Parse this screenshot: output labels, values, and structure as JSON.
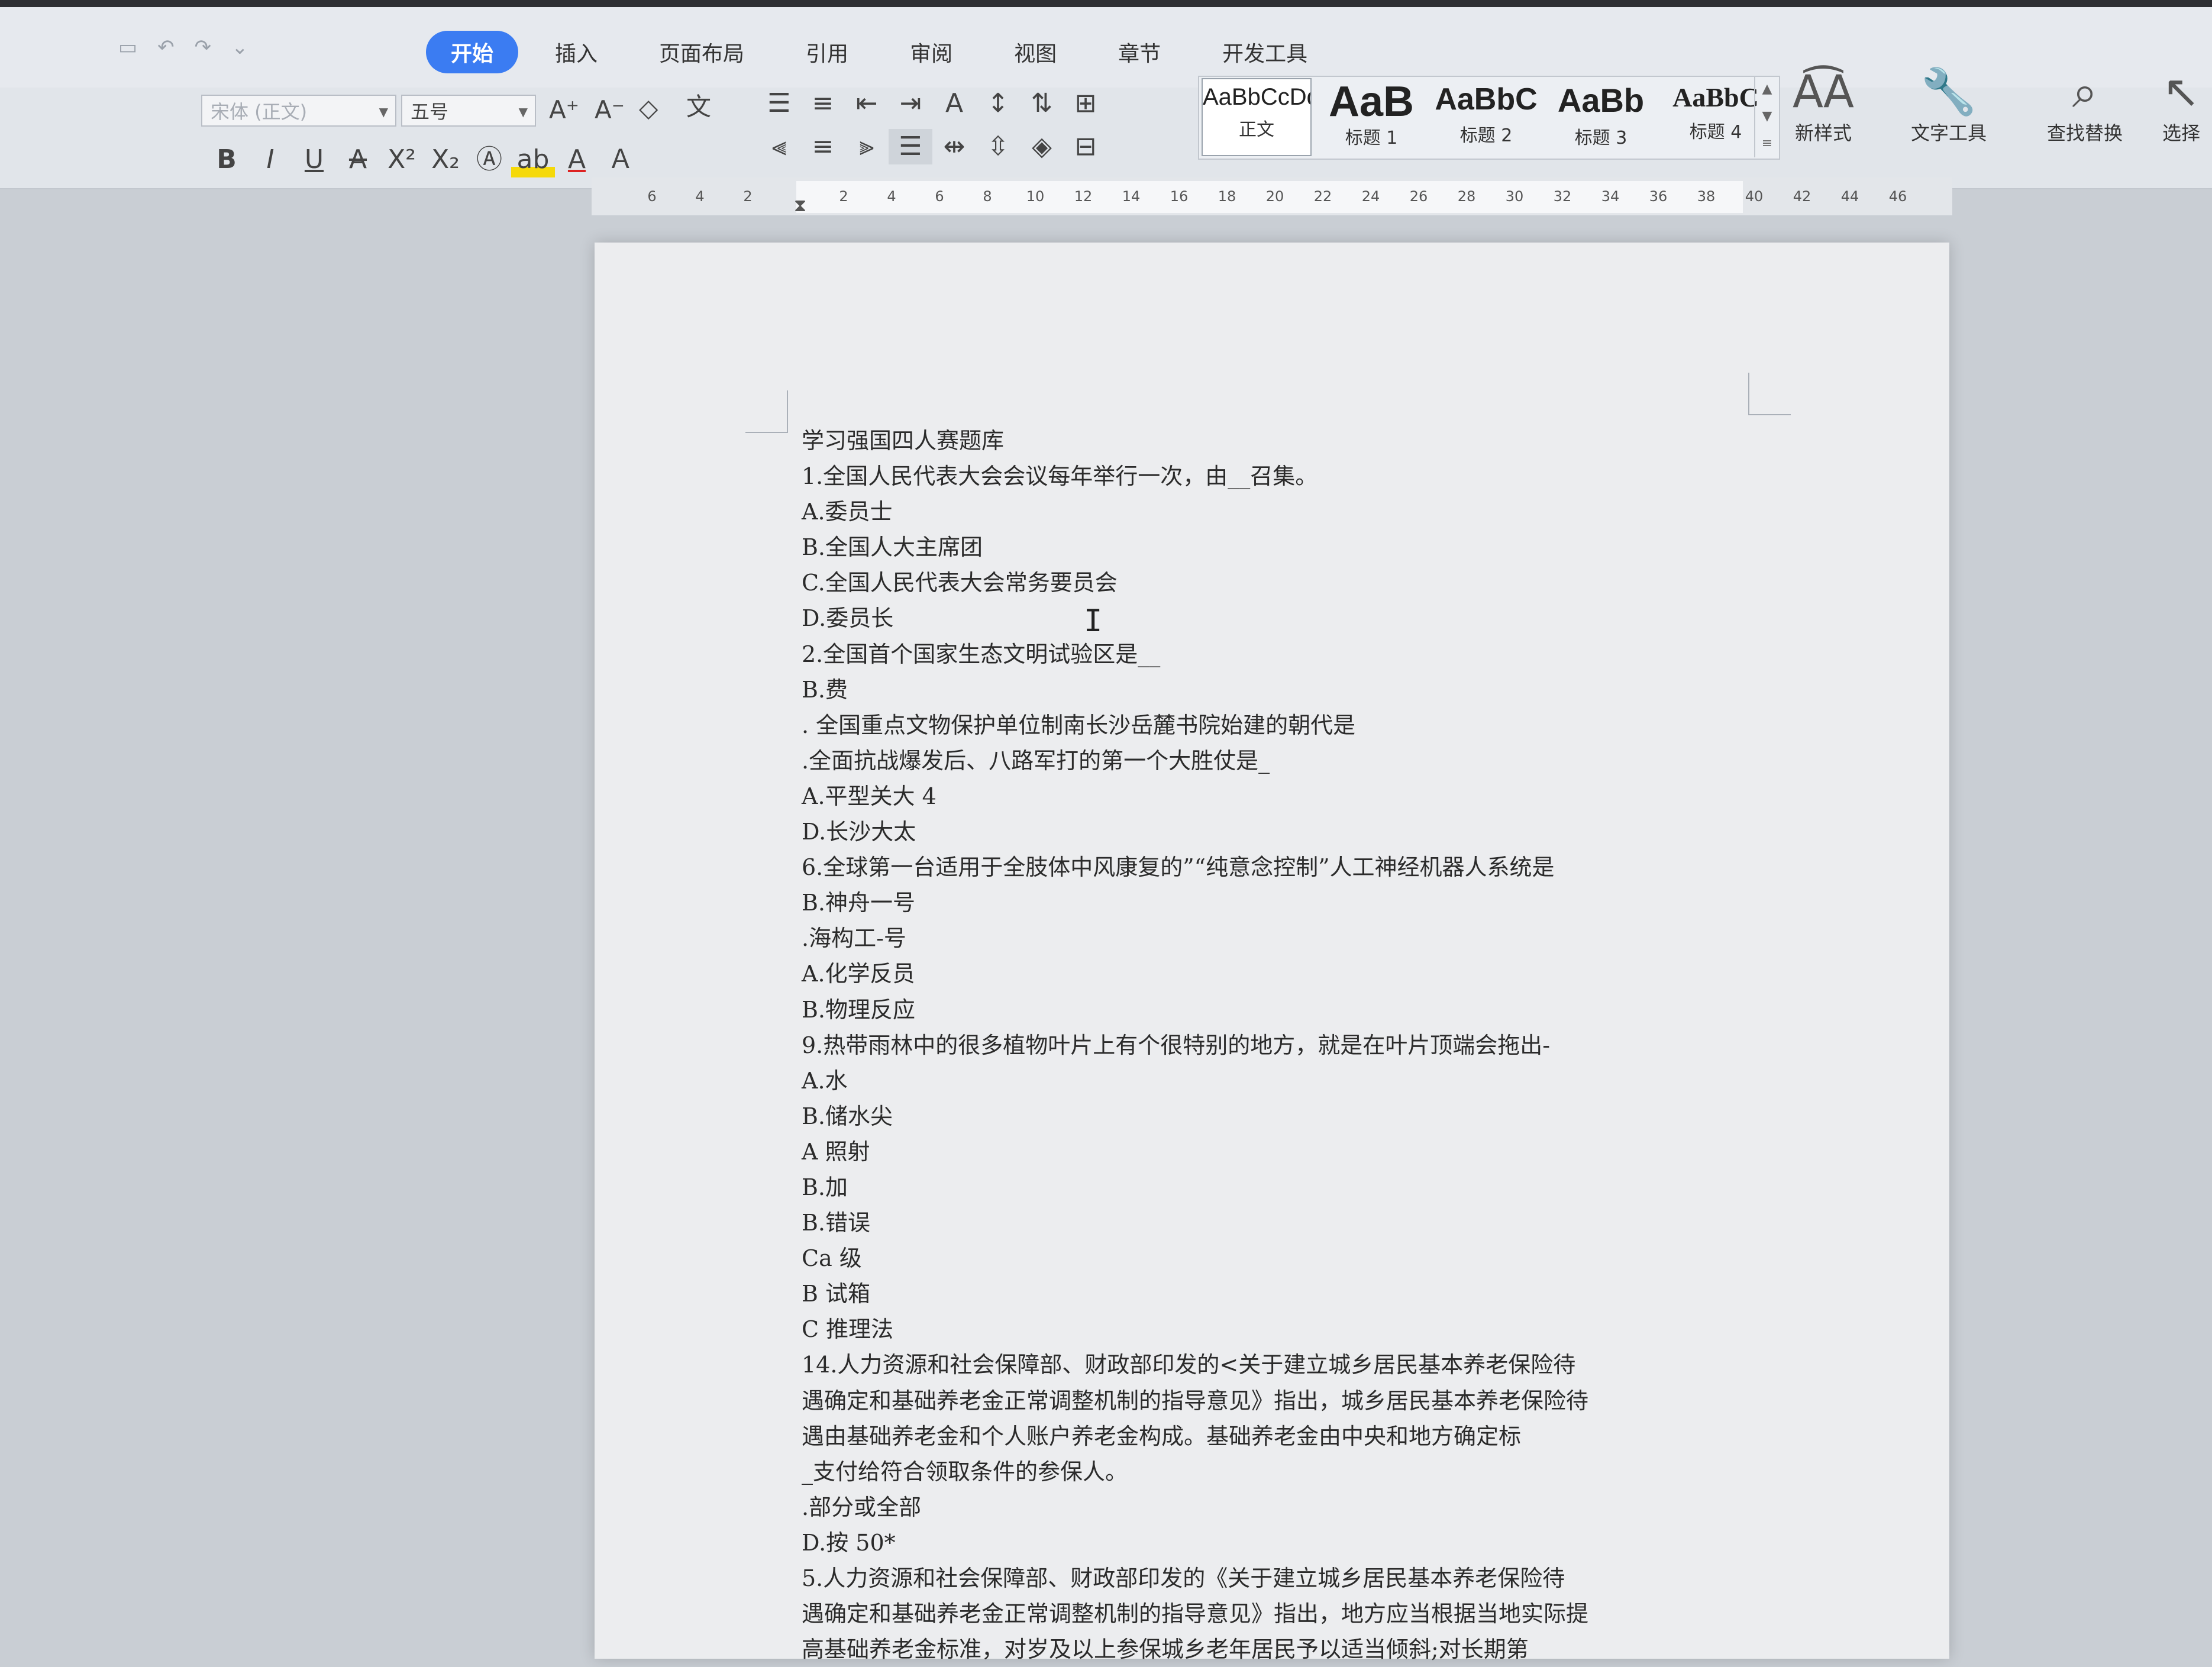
{
  "tabs": [
    {
      "label": "开始",
      "active": true
    },
    {
      "label": "插入",
      "active": false
    },
    {
      "label": "页面布局",
      "active": false
    },
    {
      "label": "引用",
      "active": false
    },
    {
      "label": "审阅",
      "active": false
    },
    {
      "label": "视图",
      "active": false
    },
    {
      "label": "章节",
      "active": false
    },
    {
      "label": "开发工具",
      "active": false
    }
  ],
  "font": {
    "family": "宋体 (正文)",
    "size": "五号"
  },
  "style_gallery": [
    {
      "sample": "AaBbCcDd",
      "label": "正文",
      "selected": true
    },
    {
      "sample": "AaB",
      "label": "标题 1",
      "selected": false
    },
    {
      "sample": "AaBbC",
      "label": "标题 2",
      "selected": false
    },
    {
      "sample": "AaBb",
      "label": "标题 3",
      "selected": false
    },
    {
      "sample": "AaBbC",
      "label": "标题 4",
      "selected": false
    }
  ],
  "tools": {
    "new_style": "新样式",
    "text_tools": "文字工具",
    "find_replace": "查找替换",
    "select": "选择"
  },
  "ruler_ticks": [
    "6",
    "4",
    "2",
    "2",
    "4",
    "6",
    "8",
    "10",
    "12",
    "14",
    "16",
    "18",
    "20",
    "22",
    "24",
    "26",
    "28",
    "30",
    "32",
    "34",
    "36",
    "38",
    "40",
    "42",
    "44",
    "46"
  ],
  "document_lines": [
    "学习强国四人赛题库",
    "1.全国人民代表大会会议每年举行一次，由__召集。",
    "A.委员士",
    "B.全国人大主席团",
    "C.全国人民代表大会常务要员会",
    "D.委员长",
    "2.全国首个国家生态文明试验区是__",
    "B.费",
    ". 全国重点文物保护单位制南长沙岳麓书院始建的朝代是",
    ".全面抗战爆发后、八路军打的第一个大胜仗是_",
    "A.平型关大 4",
    "D.长沙大太",
    "6.全球第一台适用于全肢体中风康复的”“纯意念控制”人工神经机器人系统是",
    "B.神舟一号",
    ".海构工-号",
    "A.化学反员",
    "B.物理反应",
    "9.热带雨林中的很多植物叶片上有个很特别的地方，就是在叶片顶端会拖出-",
    "A.水",
    "B.储水尖",
    "A 照射",
    "B.加",
    "B.错误",
    "Ca 级",
    "B 试箱",
    "C 推理法",
    "14.人力资源和社会保障部、财政部印发的<关于建立城乡居民基本养老保险待",
    "遇确定和基础养老金正常调整机制的指导意见》指出，城乡居民基本养老保险待",
    "遇由基础养老金和个人账户养老金构成。基础养老金由中央和地方确定标",
    "_支付给符合领取条件的参保人。",
    ".部分或全部",
    "D.按  50*",
    "5.人力资源和社会保障部、财政部印发的《关于建立城乡居民基本养老保险待",
    "遇确定和基础养老金正常调整机制的指导意见》指出，地方应当根据当地实际提",
    "高基础养老金标准，对岁及以上参保城乡老年居民予以适当倾斜;对长期第"
  ]
}
